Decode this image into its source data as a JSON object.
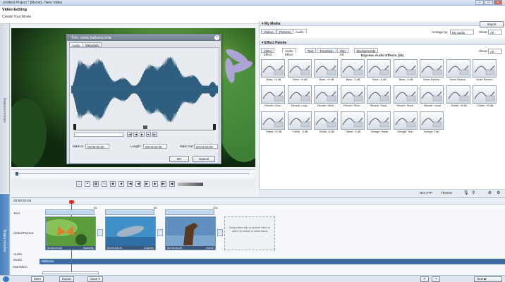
{
  "window": {
    "title": "Untitled Project * [Movie] - Nero Video"
  },
  "header": {
    "title": "Video Editing",
    "subtitle": "Create Your Movie"
  },
  "side_tabs": {
    "advanced": "Advanced Editing",
    "express": "Express Editing"
  },
  "trim_dialog": {
    "title": "Trim: comic.balloons.nola",
    "tabs": [
      "Audio",
      "Metadata"
    ],
    "mark_in_label": "Mark In:",
    "mark_in_value": "00:00:00.00",
    "length_label": "Length:",
    "length_value": "00:04:00.00",
    "mark_out_label": "Mark Out:",
    "mark_out_value": "00:04:00.00",
    "ok": "OK",
    "cancel": "Cancel"
  },
  "my_media": {
    "title": "My Media",
    "tabs": [
      "Videos",
      "Pictures",
      "Audio"
    ],
    "import": "Import",
    "arrange_by_label": "Arrange by:",
    "arrange_by_value": "My audio",
    "show_label": "Show:",
    "show_value": "All"
  },
  "effect_palette": {
    "title": "Effect Palette",
    "tabs": [
      "Video Effect",
      "Audio Effect",
      "Text",
      "Transition",
      "Clip Art",
      "Backgrounds"
    ],
    "show_label": "Show:",
    "show_value": "All",
    "section_title": "Express Audio Effects (25)",
    "effects": [
      "Bass: +3 dB",
      "Bass: +6 dB",
      "Bass: +9 dB",
      "Bass: -3 dB",
      "Bass: -6 dB",
      "Bass: -9 dB",
      "Noise Reduct...",
      "Noise Reduct...",
      "Noise Reduct...",
      "Reverb: Chur...",
      "Reverb: Larg...",
      "Reverb: Medi...",
      "Reverb: Phon...",
      "Reverb: Smal...",
      "Reverb: Stadi...",
      "Reverb: Vocal",
      "Treble: +3 dB",
      "Treble: +6 dB",
      "Treble: +9 dB",
      "Treble: -3 dB",
      "Treble: -6 dB",
      "Treble: -9 dB",
      "Vintage: Radio",
      "Vintage: Tele...",
      "Vintage: Trai..."
    ]
  },
  "timeline_toolbar": {
    "nero_fip": "Nero FIP",
    "themes": "Themes"
  },
  "timeline": {
    "timecode": "00:00:02.04",
    "tracks": [
      "Text",
      "Video/Picture",
      "Audio",
      "Music",
      "Narration"
    ],
    "ruler_marks": [
      "4s",
      "8s",
      "12s"
    ],
    "clips": [
      {
        "name": "Butterfly",
        "time": "00:00:04.00"
      },
      {
        "name": "Dolphin",
        "time": "00:00:04.00"
      },
      {
        "name": "Horse",
        "time": "00:00:04.00"
      }
    ],
    "drop_hint": "Drag video clip or picture here to add it to movie or slide show",
    "music_clip": "Balloons"
  },
  "bottom_bar": {
    "more": "More",
    "export": "Export",
    "save": "Save",
    "next": "Next"
  }
}
